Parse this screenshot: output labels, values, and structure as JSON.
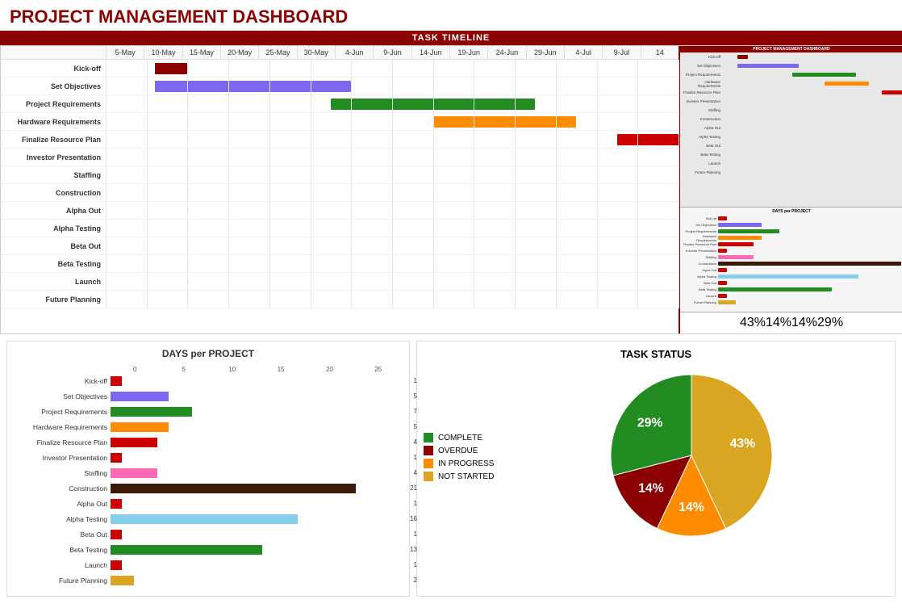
{
  "title": "PROJECT MANAGEMENT DASHBOARD",
  "timeline_header": "TASK TIMELINE",
  "dates": [
    "5-May",
    "10-May",
    "15-May",
    "20-May",
    "25-May",
    "30-May",
    "4-Jun",
    "9-Jun",
    "14-Jun",
    "19-Jun",
    "24-Jun",
    "29-Jun",
    "4-Jul",
    "9-Jul",
    "14"
  ],
  "gantt_tasks": [
    {
      "label": "Kick-off",
      "color": "#8B0000",
      "left": 1.2,
      "width": 0.8
    },
    {
      "label": "Set Objectives",
      "color": "#7B68EE",
      "left": 1.2,
      "width": 4.8
    },
    {
      "label": "Project Requirements",
      "color": "#228B22",
      "left": 5.5,
      "width": 5.0
    },
    {
      "label": "Hardware Requirements",
      "color": "#FF8C00",
      "left": 8.0,
      "width": 3.5
    },
    {
      "label": "Finalize Resource Plan",
      "color": "#CC0000",
      "left": 12.5,
      "width": 2.5
    },
    {
      "label": "Investor Presentation",
      "color": "#90EE90",
      "left": 18.5,
      "width": 1.0
    },
    {
      "label": "Staffing",
      "color": "#FF69B4",
      "left": 18.8,
      "width": 2.8
    },
    {
      "label": "Construction",
      "color": "#3B1A0A",
      "left": 19.5,
      "width": 17.0
    },
    {
      "label": "Alpha Out",
      "color": "#808080",
      "left": 32.5,
      "width": 0.7
    },
    {
      "label": "Alpha Testing",
      "color": "#87CEEB",
      "left": 32.8,
      "width": 9.5
    },
    {
      "label": "Beta Out",
      "color": "",
      "left": 0,
      "width": 0
    },
    {
      "label": "Beta Testing",
      "color": "",
      "left": 0,
      "width": 0
    },
    {
      "label": "Launch",
      "color": "",
      "left": 0,
      "width": 0
    },
    {
      "label": "Future Planning",
      "color": "",
      "left": 0,
      "width": 0
    }
  ],
  "bar_chart_title": "DAYS per PROJECT",
  "bar_max": 25,
  "bar_tasks": [
    {
      "label": "Kick-off",
      "color": "#CC0000",
      "value": 1
    },
    {
      "label": "Set Objectives",
      "color": "#7B68EE",
      "value": 5
    },
    {
      "label": "Project Requirements",
      "color": "#228B22",
      "value": 7
    },
    {
      "label": "Hardware Requirements",
      "color": "#FF8C00",
      "value": 5
    },
    {
      "label": "Finalize Resource Plan",
      "color": "#CC0000",
      "value": 4
    },
    {
      "label": "Investor Presentation",
      "color": "#CC0000",
      "value": 1
    },
    {
      "label": "Staffing",
      "color": "#FF69B4",
      "value": 4
    },
    {
      "label": "Construction",
      "color": "#3B1A0A",
      "value": 21
    },
    {
      "label": "Alpha Out",
      "color": "#CC0000",
      "value": 1
    },
    {
      "label": "Alpha Testing",
      "color": "#87CEEB",
      "value": 16
    },
    {
      "label": "Beta Out",
      "color": "#CC0000",
      "value": 1
    },
    {
      "label": "Beta Testing",
      "color": "#228B22",
      "value": 13
    },
    {
      "label": "Launch",
      "color": "#CC0000",
      "value": 1
    },
    {
      "label": "Future Planning",
      "color": "#DAA520",
      "value": 2
    }
  ],
  "bar_axis_labels": [
    "0",
    "5",
    "10",
    "15",
    "20",
    "25"
  ],
  "task_status_title": "TASK STATUS",
  "legend": [
    {
      "label": "COMPLETE",
      "color": "#228B22"
    },
    {
      "label": "OVERDUE",
      "color": "#8B0000"
    },
    {
      "label": "IN PROGRESS",
      "color": "#FF8C00"
    },
    {
      "label": "NOT STARTED",
      "color": "#DAA520"
    }
  ],
  "pie_segments": [
    {
      "label": "NOT STARTED",
      "color": "#DAA520",
      "percent": 43,
      "pct_label": "43%"
    },
    {
      "label": "IN PROGRESS",
      "color": "#FF8C00",
      "percent": 14,
      "pct_label": "14%"
    },
    {
      "label": "OVERDUE",
      "color": "#8B0000",
      "percent": 14,
      "pct_label": "14%"
    },
    {
      "label": "COMPLETE",
      "color": "#228B22",
      "percent": 29,
      "pct_label": "29%"
    }
  ],
  "colors": {
    "accent": "#8B0000",
    "header_bg": "#8B0000",
    "header_text": "#ffffff"
  }
}
